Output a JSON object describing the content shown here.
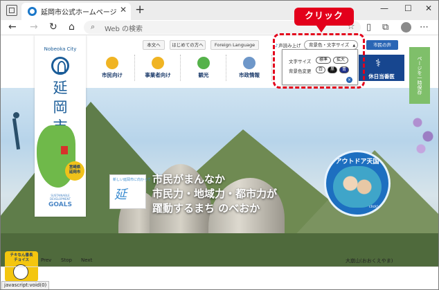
{
  "browser": {
    "tab_title": "延岡市公式ホームページ トップページ",
    "address_placeholder": "Web の検索"
  },
  "util_links": {
    "honbun": "本文へ",
    "hajimete": "はじめての方へ",
    "foreign": "Foreign Language",
    "voice": "声読み上げ",
    "color_font": "背景色・文字サイズ",
    "citizen_voice": "市民の声"
  },
  "logo": {
    "en": "Nobeoka City",
    "jp_line1": "延",
    "jp_line2": "岡",
    "jp_line3": "市",
    "badge_line1": "宮崎県",
    "badge_line2": "延岡市",
    "sdgs_small": "SUSTAINABLE DEVELOPMENT",
    "sdgs_goals": "GOALS"
  },
  "menu": {
    "items": [
      {
        "label": "市民向け"
      },
      {
        "label": "事業者向け"
      },
      {
        "label": "観光"
      },
      {
        "label": "市政情報"
      }
    ],
    "holiday": "休日当番医",
    "side_tab": "ページを一時保存"
  },
  "popup": {
    "font_size_label": "文字サイズ",
    "font_standard": "標準",
    "font_large": "拡大",
    "bg_label": "背景色変更",
    "bg_white": "白",
    "bg_black": "黒",
    "bg_blue": "青",
    "close": "×"
  },
  "annotation": {
    "callout": "クリック"
  },
  "hero": {
    "logo_small": "新しい延岡市に向かって",
    "logo_mark": "延",
    "catch_line1": "市民がまんなか",
    "catch_line2": "市民力・地域力・都市力が",
    "catch_line3": "躍動するまち のべおか",
    "outdoor_title": "アウトドア天国",
    "outdoor_click": "click!",
    "caption": "大崩山(おおくえやま)"
  },
  "slider": {
    "prev": "Prev",
    "stop": "Stop",
    "next": "Next"
  },
  "chatbot": {
    "text_line1": "チキなん番長",
    "text_line2": "チョイス"
  },
  "status": {
    "text": "javascript:void(0)"
  },
  "colors": {
    "accent_red": "#e3001b",
    "brand_blue": "#17468f"
  }
}
